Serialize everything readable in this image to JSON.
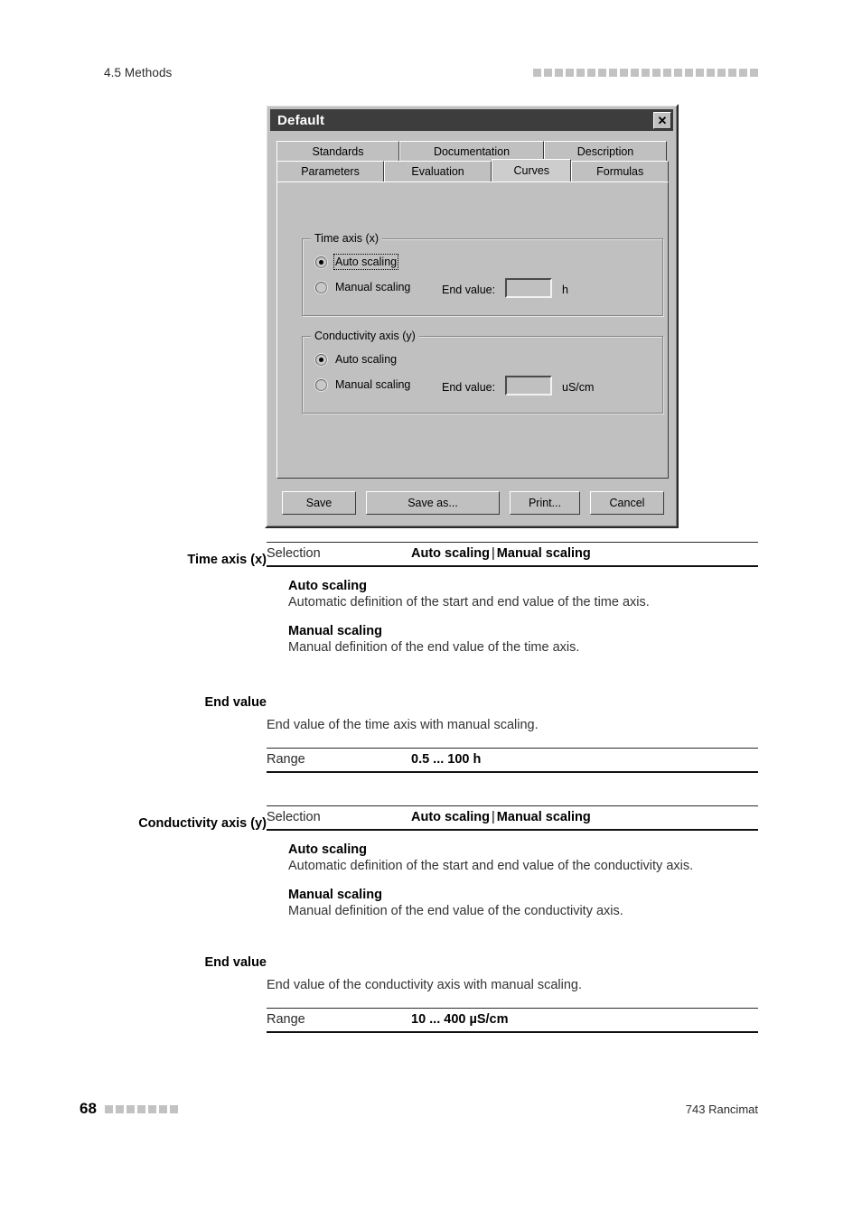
{
  "header": {
    "section_title": "4.5 Methods",
    "marker_squares": 21
  },
  "dialog": {
    "title": "Default",
    "close_label": "✕",
    "tabs_row1": [
      {
        "label": "Standards",
        "active": false
      },
      {
        "label": "Documentation",
        "active": false
      },
      {
        "label": "Description",
        "active": false
      }
    ],
    "tabs_row2": [
      {
        "label": "Parameters",
        "active": false
      },
      {
        "label": "Evaluation",
        "active": false
      },
      {
        "label": "Curves",
        "active": true
      },
      {
        "label": "Formulas",
        "active": false
      }
    ],
    "time_axis_group": {
      "legend": "Time axis (x)",
      "auto_label": "Auto scaling",
      "manual_label": "Manual scaling",
      "end_value_label": "End value:",
      "end_value": "",
      "unit": "h",
      "selected": "auto"
    },
    "conductivity_axis_group": {
      "legend": "Conductivity axis (y)",
      "auto_label": "Auto scaling",
      "manual_label": "Manual scaling",
      "end_value_label": "End value:",
      "end_value": "",
      "unit": "uS/cm",
      "selected": "auto"
    },
    "buttons": {
      "save": "Save",
      "save_as": "Save as...",
      "print": "Print...",
      "cancel": "Cancel"
    }
  },
  "doc": {
    "time_axis": {
      "heading": "Time axis (x)",
      "selection_label": "Selection",
      "selection_value_a": "Auto scaling",
      "selection_separator": "|",
      "selection_value_b": "Manual scaling",
      "auto_head": "Auto scaling",
      "auto_text": "Automatic definition of the start and end value of the time axis.",
      "manual_head": "Manual scaling",
      "manual_text": "Manual definition of the end value of the time axis."
    },
    "time_end_value": {
      "heading": "End value",
      "text": "End value of the time axis with manual scaling.",
      "range_label": "Range",
      "range_value": "0.5 ... 100 h"
    },
    "conductivity_axis": {
      "heading": "Conductivity axis (y)",
      "selection_label": "Selection",
      "selection_value_a": "Auto scaling",
      "selection_separator": "|",
      "selection_value_b": "Manual scaling",
      "auto_head": "Auto scaling",
      "auto_text": "Automatic definition of the start and end value of the conductivity axis.",
      "manual_head": "Manual scaling",
      "manual_text": "Manual definition of the end value of the conductivity axis."
    },
    "conductivity_end_value": {
      "heading": "End value",
      "text": "End value of the conductivity axis with manual scaling.",
      "range_label": "Range",
      "range_value": "10 ... 400 µS/cm"
    }
  },
  "footer": {
    "page_number": "68",
    "marker_squares": 7,
    "product": "743 Rancimat"
  },
  "colors": {
    "dialog_face": "#c0c0c0",
    "titlebar": "#3d3d3d",
    "page_bg": "#ffffff",
    "marker_square": "#c2c2c2"
  }
}
